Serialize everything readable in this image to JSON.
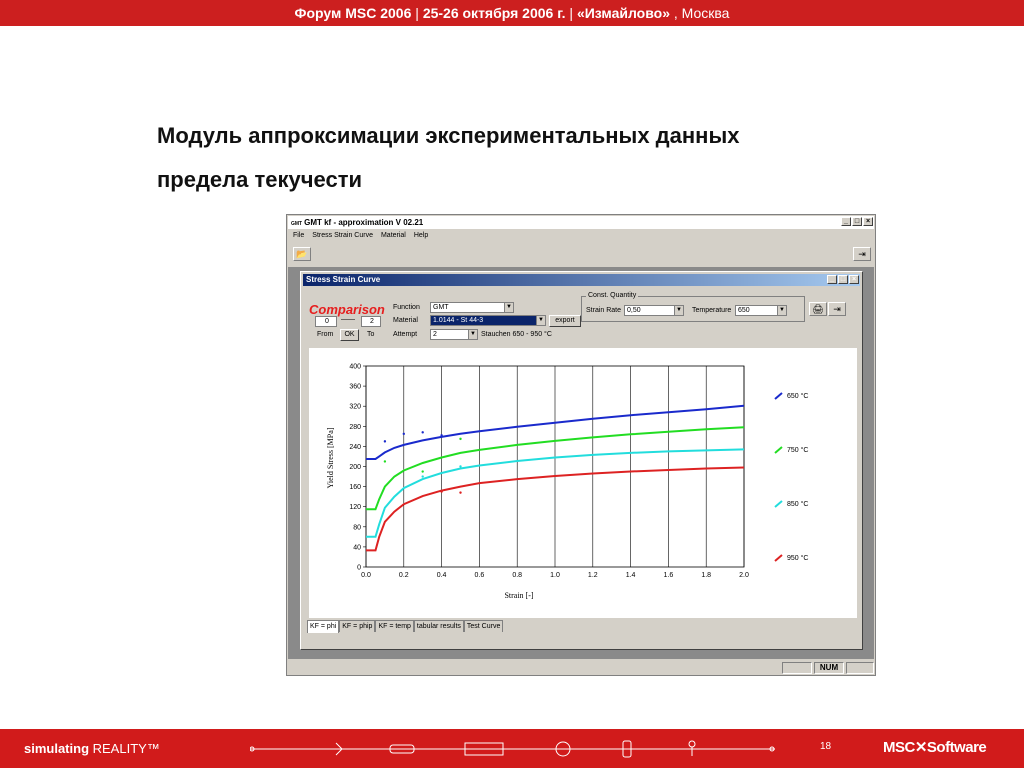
{
  "header": {
    "part1": "Форум MSC 2006",
    "sep1": " | ",
    "part2": "25-26 октября 2006 г.",
    "sep2": " | ",
    "part3": "«Измайлово»",
    "part4": " , Москва"
  },
  "slide_title": {
    "line1": "Модуль аппроксимации экспериментальных данных",
    "line2": "предела текучести"
  },
  "app": {
    "logo": "GMT",
    "title": "GMT  kf - approximation  V 02.21",
    "menu": [
      "File",
      "Stress Strain Curve",
      "Material",
      "Help"
    ],
    "child_title": "Stress Strain Curve",
    "comparison": "Comparison",
    "from_value": "0",
    "to_value": "2",
    "from_label": "From",
    "ok_label": "OK",
    "to_label": "To",
    "function_label": "Function",
    "function_value": "GMT",
    "material_label": "Material",
    "material_value": "1.0144  - St 44-3",
    "attempt_label": "Attempt",
    "attempt_value": "2",
    "attempt_note": "Stauchen 650 - 950 °C",
    "export_label": "export",
    "const_group": "Const. Quantity",
    "strain_rate_label": "Strain Rate",
    "strain_rate_value": "0,50",
    "temperature_label": "Temperature",
    "temperature_value": "650",
    "tabs": [
      "KF = phi",
      "KF = phip",
      "KF = temp",
      "tabular results",
      "Test Curve"
    ],
    "status_num": "NUM"
  },
  "footer": {
    "brand_bold": "simulating",
    "brand_rest": " REALITY™",
    "page": "18",
    "logo": "MSC✕Software"
  },
  "chart_data": {
    "type": "line",
    "xlabel": "Strain [-]",
    "ylabel": "Yield Stress [MPa]",
    "xlim": [
      0.0,
      2.0
    ],
    "ylim": [
      0,
      400
    ],
    "x_ticks": [
      "0.0",
      "0.2",
      "0.4",
      "0.6",
      "0.8",
      "1.0",
      "1.2",
      "1.4",
      "1.6",
      "1.8",
      "2.0"
    ],
    "y_ticks": [
      "0",
      "40",
      "80",
      "120",
      "160",
      "200",
      "240",
      "280",
      "320",
      "360",
      "400"
    ],
    "grid": "vertical",
    "legend_position": "right",
    "x": [
      0.0,
      0.05,
      0.07,
      0.1,
      0.15,
      0.2,
      0.3,
      0.4,
      0.5,
      0.6,
      0.8,
      1.0,
      1.2,
      1.4,
      1.6,
      1.8,
      2.0
    ],
    "series": [
      {
        "name": "650 °C",
        "color": "#1a2acc",
        "values": [
          215,
          215,
          220,
          228,
          237,
          243,
          252,
          259,
          265,
          270,
          279,
          287,
          295,
          302,
          308,
          314,
          321
        ]
      },
      {
        "name": "750 °C",
        "color": "#22dd22",
        "values": [
          115,
          115,
          135,
          160,
          180,
          192,
          207,
          218,
          227,
          233,
          243,
          251,
          258,
          264,
          269,
          274,
          278
        ]
      },
      {
        "name": "850 °C",
        "color": "#22dddd",
        "values": [
          60,
          60,
          85,
          118,
          140,
          157,
          175,
          187,
          196,
          202,
          211,
          218,
          223,
          227,
          230,
          232,
          234
        ]
      },
      {
        "name": "950 °C",
        "color": "#dd2222",
        "values": [
          33,
          33,
          60,
          90,
          110,
          125,
          141,
          152,
          160,
          167,
          175,
          181,
          186,
          190,
          193,
          196,
          198
        ]
      }
    ],
    "measured_points": [
      {
        "series": "650 °C",
        "points": [
          [
            0.1,
            250
          ],
          [
            0.2,
            265
          ],
          [
            0.3,
            268
          ],
          [
            0.4,
            262
          ]
        ]
      },
      {
        "series": "750 °C",
        "points": [
          [
            0.1,
            210
          ],
          [
            0.3,
            190
          ],
          [
            0.5,
            255
          ]
        ]
      },
      {
        "series": "850 °C",
        "points": [
          [
            0.3,
            180
          ],
          [
            0.5,
            200
          ]
        ]
      },
      {
        "series": "950 °C",
        "points": [
          [
            0.4,
            150
          ],
          [
            0.5,
            148
          ]
        ]
      }
    ]
  }
}
